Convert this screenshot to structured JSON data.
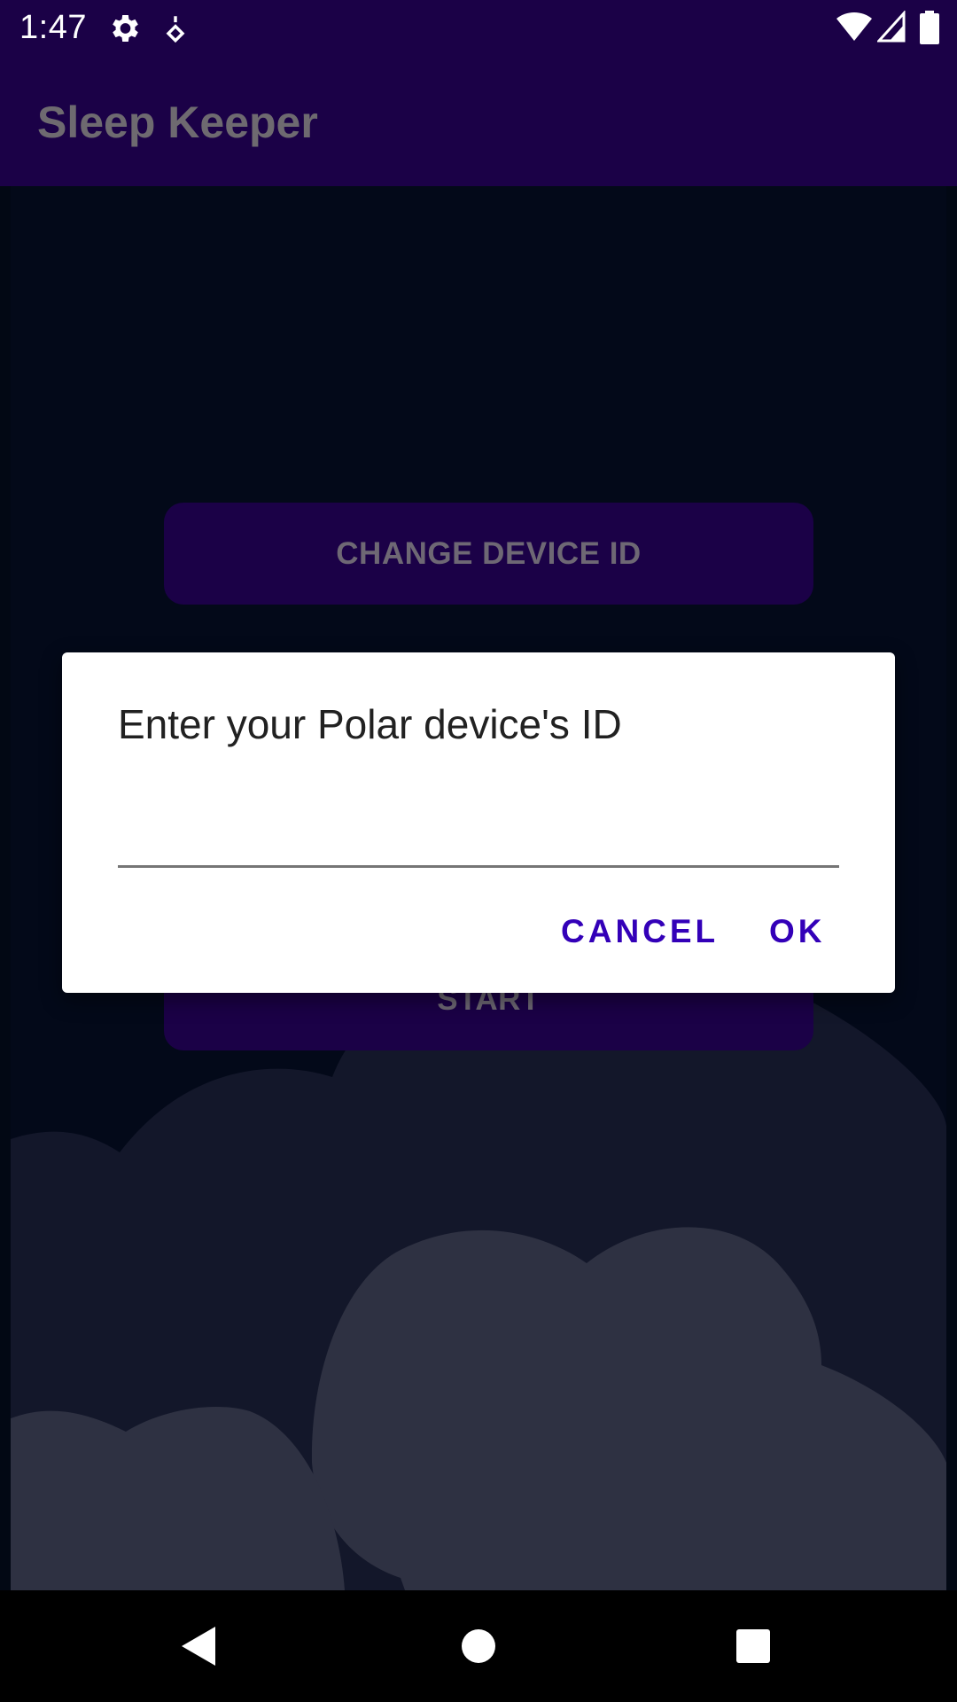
{
  "status_bar": {
    "time": "1:47",
    "icons": [
      "gear-icon",
      "location-pin-icon",
      "wifi-icon",
      "cell-signal-icon",
      "battery-icon"
    ]
  },
  "app_bar": {
    "title": "Sleep Keeper"
  },
  "main": {
    "change_device_label": "CHANGE DEVICE ID",
    "start_label": "START"
  },
  "dialog": {
    "title": "Enter your Polar device's ID",
    "input_value": "",
    "cancel_label": "CANCEL",
    "ok_label": "OK",
    "accent_color": "#3300b8"
  },
  "nav_bar": {
    "icons": [
      "back-icon",
      "home-icon",
      "recents-icon"
    ]
  },
  "colors": {
    "primary": "#1b0147",
    "background": "#030919",
    "cloud_dark": "#13172a",
    "cloud_light": "#2e3142"
  }
}
